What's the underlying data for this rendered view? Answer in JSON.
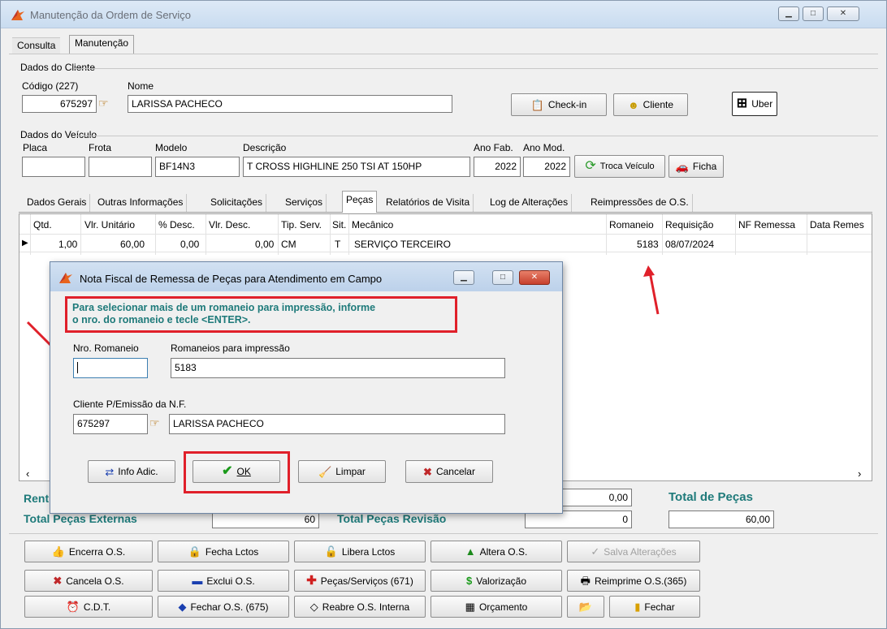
{
  "window": {
    "title": "Manutenção da Ordem de Serviço",
    "min": "▁",
    "max": "□",
    "close": "✕"
  },
  "tabs": [
    "Consulta",
    "Manutenção"
  ],
  "cliente": {
    "group": "Dados do Cliente",
    "codigo_label": "Código (227)",
    "codigo": "675297",
    "nome_label": "Nome",
    "nome": "LARISSA PACHECO",
    "checkin": "Check-in",
    "cliente_btn": "Cliente",
    "uber": "Uber"
  },
  "veiculo": {
    "group": "Dados do Veículo",
    "placa_label": "Placa",
    "frota_label": "Frota",
    "modelo_label": "Modelo",
    "modelo": "BF14N3",
    "descricao_label": "Descrição",
    "descricao": "T CROSS HIGHLINE 250 TSI AT 150HP",
    "anofab_label": "Ano Fab.",
    "anofab": "2022",
    "anomod_label": "Ano Mod.",
    "anomod": "2022",
    "troca": "Troca Veículo",
    "ficha": "Ficha"
  },
  "subtabs": [
    "Dados Gerais",
    "Outras Informações",
    "Solicitações",
    "Serviços",
    "Peças",
    "Relatórios de Visita",
    "Log de Alterações",
    "Reimpressões de O.S."
  ],
  "grid": {
    "headers": [
      "Qtd.",
      "Vlr. Unitário",
      "% Desc.",
      "Vlr. Desc.",
      "Tip. Serv.",
      "Sit.",
      "Mecânico",
      "Romaneio",
      "Requisição",
      "NF Remessa",
      "Data Remes"
    ],
    "row": {
      "qtd": "1,00",
      "unit": "60,00",
      "pdesc": "0,00",
      "vdesc": "0,00",
      "tip": "CM",
      "sit": "T",
      "mec": "SERVIÇO TERCEIRO",
      "rom": "5183",
      "req": "08/07/2024"
    }
  },
  "totais": {
    "rent_label": "Rent",
    "ext_label": "Total Peças Externas",
    "ext": "60",
    "rev_label": "Total Peças Revisão",
    "rev": "0",
    "v1": "0,00",
    "pecas_label": "Total de Peças",
    "pecas": "60,00"
  },
  "buttons": {
    "encerra": "Encerra O.S.",
    "fecha_lctos": "Fecha Lctos",
    "libera": "Libera Lctos",
    "altera": "Altera O.S.",
    "salva": "Salva Alterações",
    "cancela": "Cancela O.S.",
    "exclui": "Exclui O.S.",
    "pecas": "Peças/Serviços (671)",
    "valorizacao": "Valorização",
    "reimprime": "Reimprime O.S.(365)",
    "cdt": "C.D.T.",
    "fechar_os": "Fechar O.S. (675)",
    "reabre": "Reabre O.S. Interna",
    "orcamento": "Orçamento",
    "fechar": "Fechar"
  },
  "dialog": {
    "title": "Nota Fiscal de Remessa de Peças para Atendimento em Campo",
    "msg1": "Para selecionar mais de um romaneio para impressão, informe",
    "msg2": "o nro. do romaneio e tecle <ENTER>.",
    "nro_label": "Nro. Romaneio",
    "nro": "",
    "rom_label": "Romaneios para impressão",
    "rom": "5183",
    "cli_label": "Cliente P/Emissão da N.F.",
    "cli_cod": "675297",
    "cli_nome": "LARISSA PACHECO",
    "info": "Info Adic.",
    "ok": "OK",
    "limpar": "Limpar",
    "cancelar": "Cancelar"
  },
  "colors": {
    "accent": "#1e7a7a",
    "annotation": "#e0202a"
  }
}
